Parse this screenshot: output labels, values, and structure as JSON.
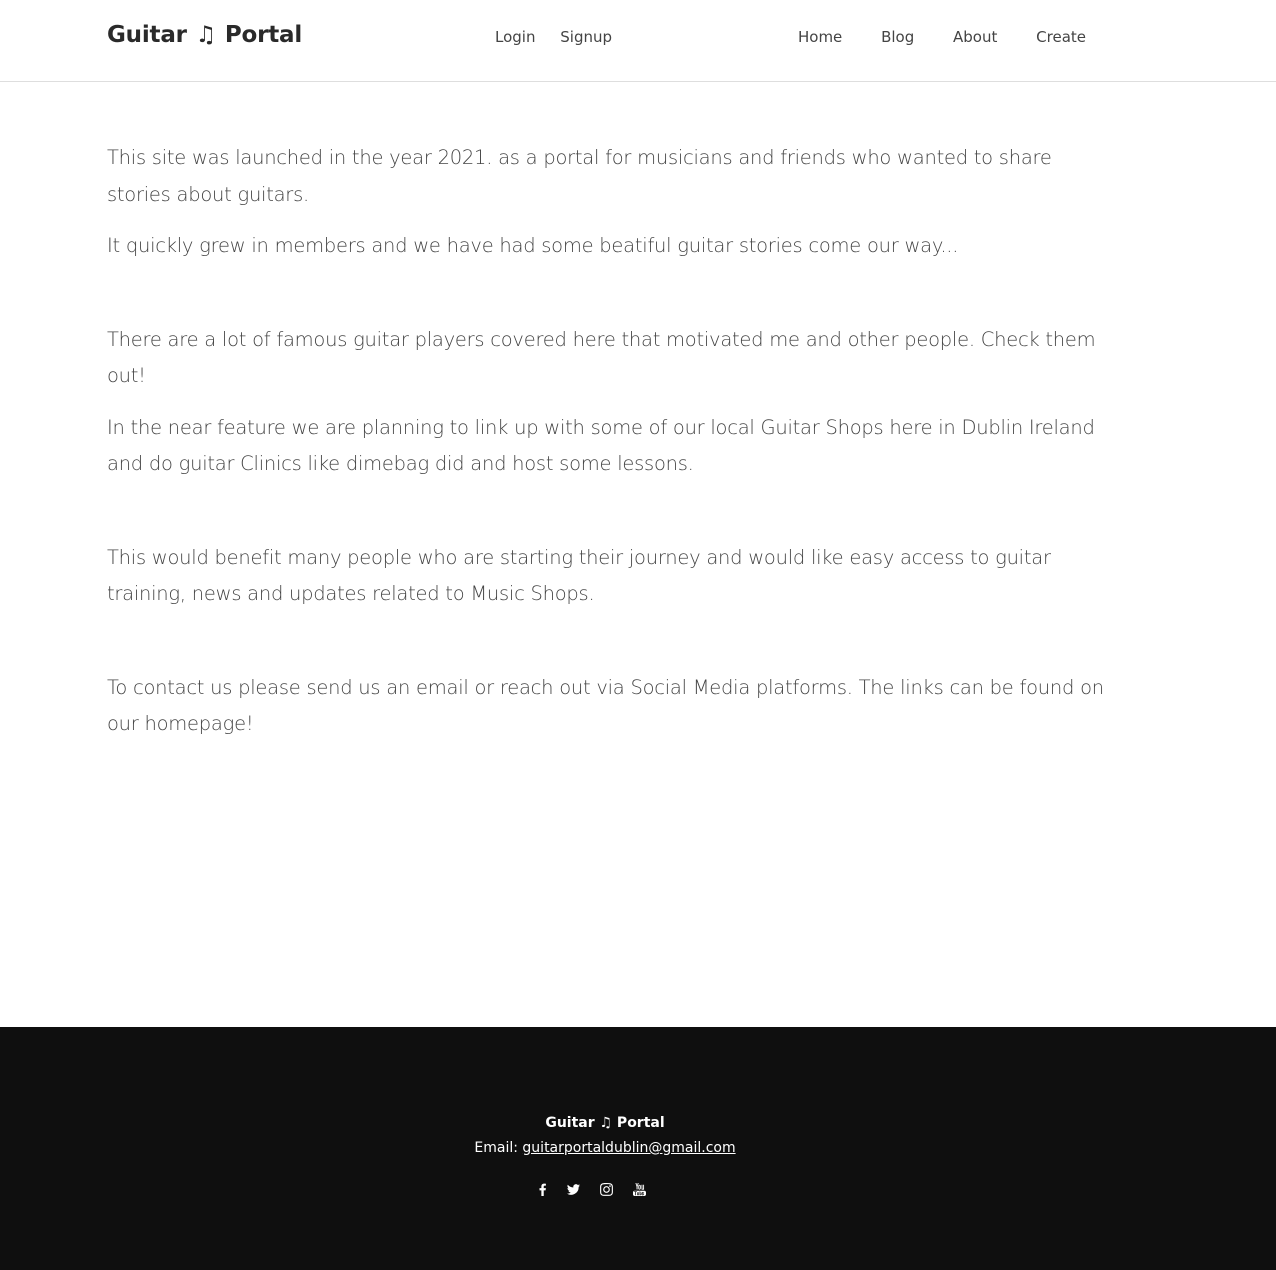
{
  "header": {
    "brand": {
      "left": "Guitar",
      "note": "♫",
      "right": "Portal"
    },
    "auth": [
      "Login",
      "Signup"
    ],
    "nav": [
      "Home",
      "Blog",
      "About",
      "Create"
    ]
  },
  "content": {
    "paragraphs": [
      "This site was launched in the year 2021. as a portal for musicians and friends who wanted to share stories about guitars.",
      "It quickly grew in members and we have had some beatiful guitar stories come our way...",
      "There are a lot of famous guitar players covered here that motivated me and other people. Check them out!",
      "In the near feature we are planning to link up with some of our local Guitar Shops here in Dublin Ireland and do guitar Clinics like dimebag did and host some lessons.",
      "This would benefit many people who are starting their journey and would like easy access to guitar training, news and updates related to Music Shops.",
      "To contact us please send us an email or reach out via Social Media platforms. The links can be found on our homepage!"
    ]
  },
  "footer": {
    "brand": "Guitar ♫ Portal",
    "email_label": "Email:",
    "email": "guitarportaldublin@gmail.com",
    "social": [
      "facebook-icon",
      "twitter-icon",
      "instagram-icon",
      "youtube-icon"
    ]
  },
  "colors": {
    "footer_bg": "#0f0f0f",
    "text": "#444444",
    "border": "#dedede"
  }
}
